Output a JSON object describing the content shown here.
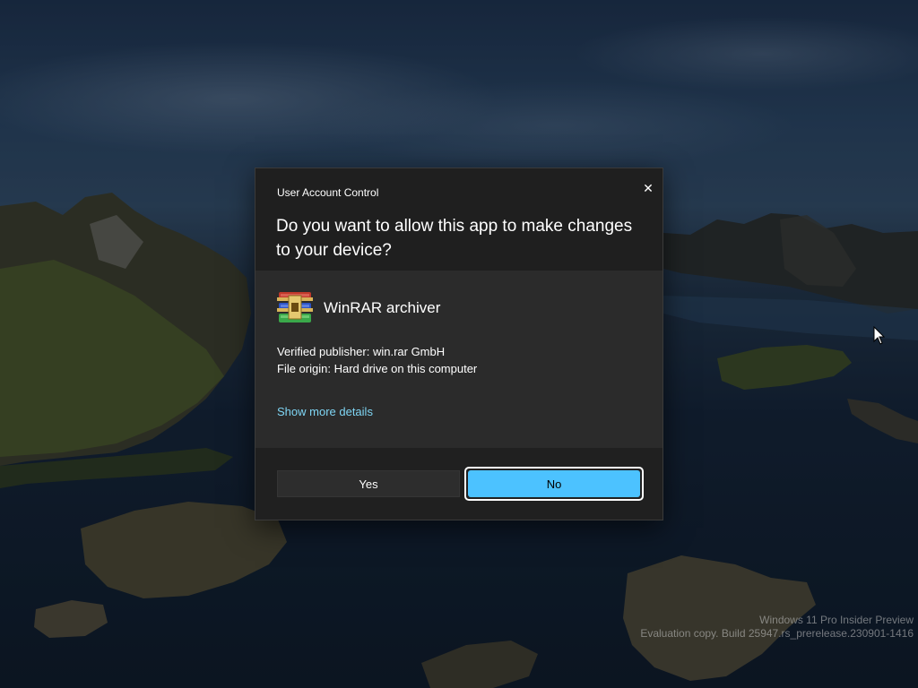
{
  "dialog": {
    "caption": "User Account Control",
    "question": "Do you want to allow this app to make changes to your device?",
    "app_name": "WinRAR archiver",
    "publisher": "Verified publisher: win.rar GmbH",
    "file_origin": "File origin: Hard drive on this computer",
    "details_link": "Show more details",
    "yes_label": "Yes",
    "no_label": "No",
    "close_glyph": "✕"
  },
  "watermark": {
    "line1": "Windows 11 Pro Insider Preview",
    "line2": "Evaluation copy. Build 25947.rs_prerelease.230901-1416"
  },
  "icons": {
    "app": "winrar-icon",
    "close": "close-icon",
    "cursor": "mouse-pointer-icon"
  },
  "colors": {
    "accent": "#4cc2ff",
    "link": "#7fd6f5",
    "dialog_header": "#1f1f1f",
    "dialog_body": "#2b2b2b"
  }
}
